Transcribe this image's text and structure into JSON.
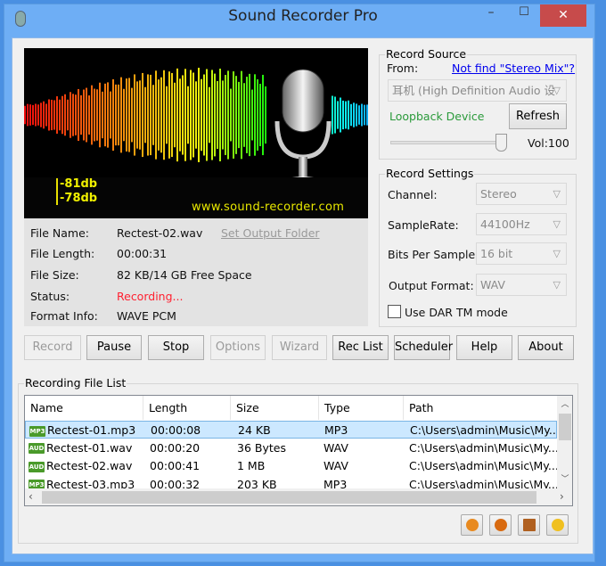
{
  "window": {
    "title": "Sound Recorder Pro",
    "minimize": "–",
    "maximize": "☐",
    "close": "✕"
  },
  "visualizer": {
    "level1": "-81db",
    "level2": "-78db",
    "url": "www.sound-recorder.com"
  },
  "info": {
    "file_name_label": "File Name:",
    "file_name": "Rectest-02.wav",
    "set_output": "Set Output Folder",
    "file_length_label": "File Length:",
    "file_length": "00:00:31",
    "file_size_label": "File Size:",
    "file_size": "82 KB/14 GB Free Space",
    "status_label": "Status:",
    "status": "Recording...",
    "format_label": "Format Info:",
    "format": "WAVE PCM"
  },
  "toolbar": {
    "record": "Record",
    "pause": "Pause",
    "stop": "Stop",
    "options": "Options",
    "wizard": "Wizard",
    "rec_list": "Rec List",
    "scheduler": "Scheduler",
    "help": "Help",
    "about": "About"
  },
  "record_source": {
    "title": "Record Source",
    "from_label": "From:",
    "stereo_mix_link": "Not find \"Stereo Mix\"?",
    "device": "耳机 (High Definition Audio 设",
    "loopback": "Loopback Device",
    "refresh": "Refresh",
    "volume_label": "Vol:",
    "volume": "100",
    "volume_fraction": 1.0
  },
  "record_settings": {
    "title": "Record Settings",
    "channel_label": "Channel:",
    "channel": "Stereo",
    "samplerate_label": "SampleRate:",
    "samplerate": "44100Hz",
    "bits_label": "Bits Per Sample:",
    "bits": "16 bit",
    "format_label": "Output Format:",
    "format": "WAV",
    "dar_label": "Use DAR TM mode",
    "dar_checked": false
  },
  "file_list": {
    "title": "Recording File List",
    "columns": [
      "Name",
      "Length",
      "Size",
      "Type",
      "Path"
    ],
    "rows": [
      {
        "icon": "MP3",
        "name": "Rectest-01.mp3",
        "length": "00:00:08",
        "size": "24 KB",
        "type": "MP3",
        "path": "C:\\Users\\admin\\Music\\My..."
      },
      {
        "icon": "AUD",
        "name": "Rectest-01.wav",
        "length": "00:00:20",
        "size": "36 Bytes",
        "type": "WAV",
        "path": "C:\\Users\\admin\\Music\\My..."
      },
      {
        "icon": "AUD",
        "name": "Rectest-02.wav",
        "length": "00:00:41",
        "size": "1 MB",
        "type": "WAV",
        "path": "C:\\Users\\admin\\Music\\My..."
      },
      {
        "icon": "MP3",
        "name": "Rectest-03.mp3",
        "length": "00:00:32",
        "size": "203 KB",
        "type": "MP3",
        "path": "C:\\Users\\admin\\Music\\My..."
      }
    ]
  }
}
